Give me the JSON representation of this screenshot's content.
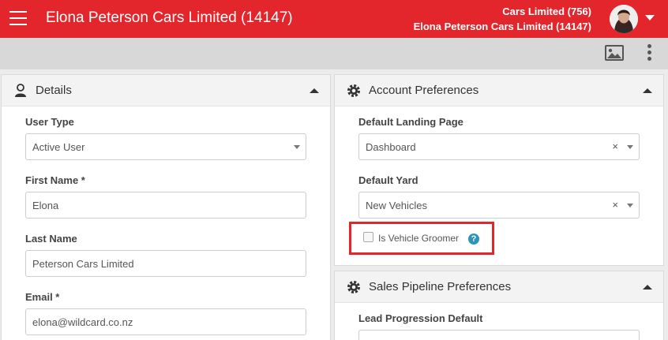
{
  "header": {
    "title": "Elona Peterson Cars Limited (14147)",
    "account_line1": "Cars Limited (756)",
    "account_line2": "Elona Peterson Cars Limited (14147)",
    "accent": "#e3262c"
  },
  "toolbar": {
    "image_icon": "image-icon",
    "more_icon": "more-vertical-icon"
  },
  "details": {
    "title": "Details",
    "icon": "user-icon",
    "user_type_label": "User Type",
    "user_type_value": "Active User",
    "first_name_label": "First Name *",
    "first_name_value": "Elona",
    "last_name_label": "Last Name",
    "last_name_value": "Peterson Cars Limited",
    "email_label": "Email *",
    "email_value": "elona@wildcard.co.nz"
  },
  "account_prefs": {
    "title": "Account Preferences",
    "icon": "gear-icon",
    "landing_label": "Default Landing Page",
    "landing_value": "Dashboard",
    "yard_label": "Default Yard",
    "yard_value": "New Vehicles",
    "clear_glyph": "×",
    "groomer_label": "Is Vehicle Groomer",
    "groomer_checked": false,
    "help_glyph": "?"
  },
  "sales_prefs": {
    "title": "Sales Pipeline Preferences",
    "icon": "gear-icon",
    "lead_label": "Lead Progression Default"
  }
}
